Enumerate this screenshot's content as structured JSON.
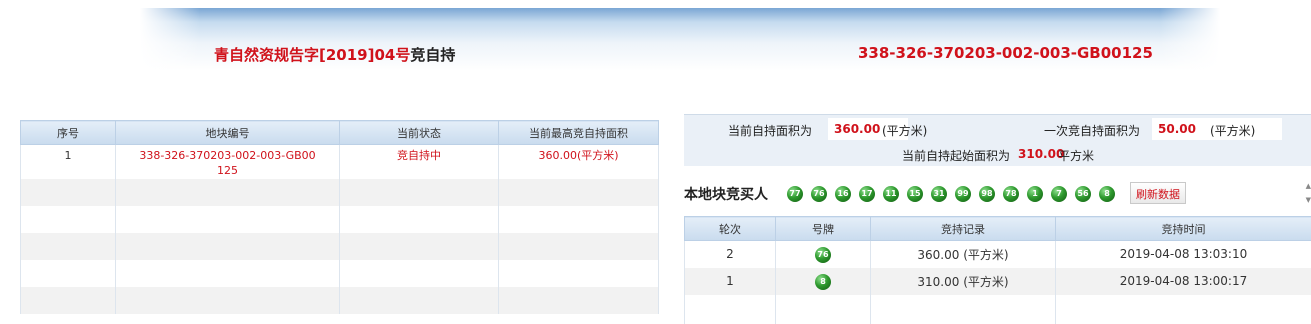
{
  "header": {
    "notice_prefix": "青自然资规告字[2019]04号",
    "notice_suffix": "竞自持",
    "parcel_code": "338-326-370203-002-003-GB00125"
  },
  "left_table": {
    "columns": [
      "序号",
      "地块编号",
      "当前状态",
      "当前最高竞自持面积"
    ],
    "rows": [
      {
        "index": "1",
        "parcel": "338-326-370203-002-003-GB00125",
        "status": "竞自持中",
        "area": "360.00(平方米)"
      }
    ]
  },
  "info": {
    "current_area_label": "当前自持面积为",
    "current_area_value": "360.00",
    "unit": "(平方米)",
    "increment_label": "一次竞自持面积为",
    "increment_value": "50.00",
    "start_label": "当前自持起始面积为",
    "start_value": "310.00",
    "start_unit": "平方米"
  },
  "bidders": {
    "title": "本地块竞买人",
    "numbers": [
      "77",
      "76",
      "16",
      "17",
      "11",
      "15",
      "31",
      "99",
      "98",
      "78",
      "1",
      "7",
      "56",
      "8"
    ],
    "refresh_label": "刷新数据"
  },
  "record_table": {
    "columns": [
      "轮次",
      "号牌",
      "竞持记录",
      "竞持时间"
    ],
    "rows": [
      {
        "round": "2",
        "plate": "76",
        "record": "360.00 (平方米)",
        "time": "2019-04-08 13:03:10"
      },
      {
        "round": "1",
        "plate": "8",
        "record": "310.00 (平方米)",
        "time": "2019-04-08 13:00:17"
      }
    ]
  },
  "colors": {
    "accent_red": "#d0121b",
    "header_blue": "#c9dbee",
    "ball_green": "#2f9a2f"
  }
}
